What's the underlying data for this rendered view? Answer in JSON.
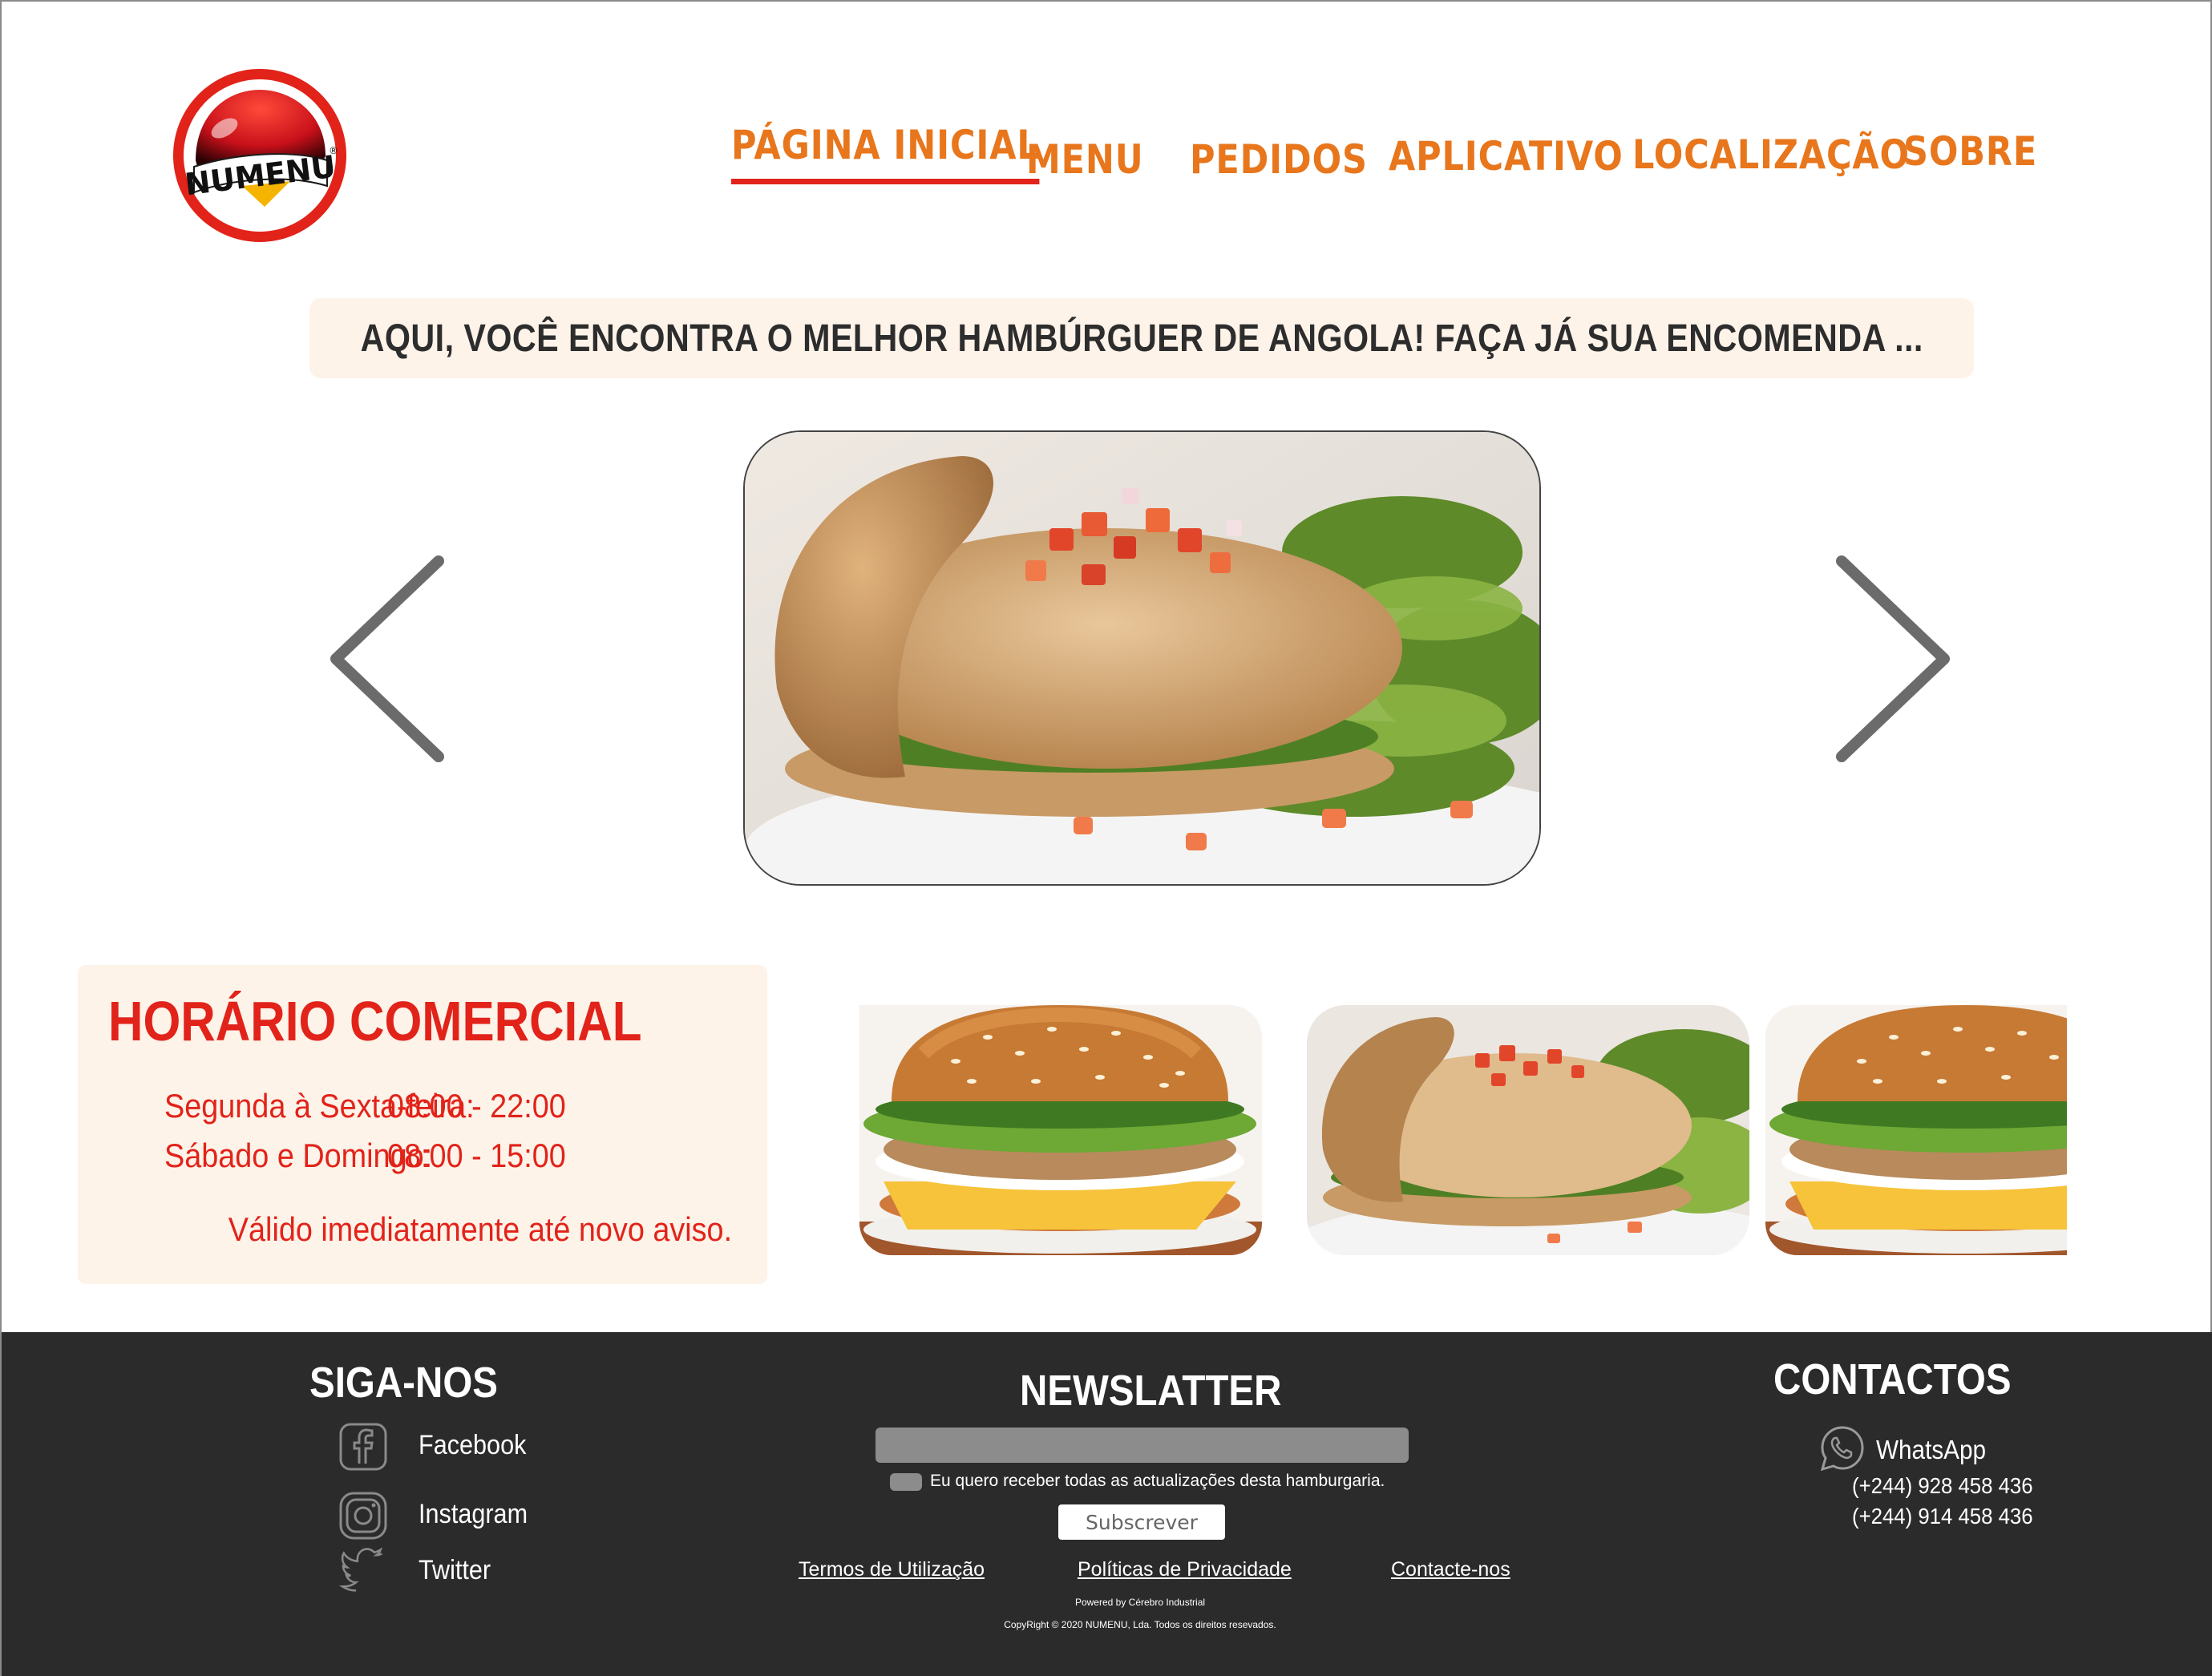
{
  "brand": {
    "logo_text": "NUMENU",
    "logo_registered": "®",
    "primary_color": "#e2231a",
    "nav_color": "#e8761c",
    "cream": "#fdf3e9",
    "footer_bg": "#2b2b2b"
  },
  "nav": {
    "items": [
      {
        "label": "PÁGINA INICIAL",
        "active": true
      },
      {
        "label": "MENU",
        "active": false
      },
      {
        "label": "PEDIDOS",
        "active": false
      },
      {
        "label": "APLICATIVO",
        "active": false
      },
      {
        "label": "LOCALIZAÇÃO",
        "active": false
      },
      {
        "label": "SOBRE",
        "active": false
      }
    ]
  },
  "tagline": "AQUI, VOCÊ ENCONTRA O MELHOR HAMBÚRGUER DE ANGOLA! FAÇA JÁ SUA ENCOMENDA ...",
  "carousel": {
    "prev_icon": "chevron-left-icon",
    "next_icon": "chevron-right-icon"
  },
  "hours": {
    "title": "HORÁRIO COMERCIAL",
    "rows": [
      {
        "days": "Segunda à Sexta-feira:",
        "time": "08:00 - 22:00"
      },
      {
        "days": "Sábado e Domingo:",
        "time": "08:00 - 15:00"
      }
    ],
    "note": "Válido imediatamente até novo aviso."
  },
  "footer": {
    "follow": {
      "title": "SIGA-NOS",
      "items": [
        {
          "label": "Facebook",
          "icon": "facebook-icon"
        },
        {
          "label": "Instagram",
          "icon": "instagram-icon"
        },
        {
          "label": "Twitter",
          "icon": "twitter-icon"
        }
      ]
    },
    "newsletter": {
      "title": "NEWSLATTER",
      "input_value": "",
      "checkbox_label": "Eu quero receber todas as actualizações desta hamburgaria.",
      "button": "Subscrever"
    },
    "contacts": {
      "title": "CONTACTOS",
      "whatsapp_label": "WhatsApp",
      "phones": [
        "(+244) 928 458 436",
        "(+244) 914 458 436"
      ]
    },
    "links": [
      "Termos de Utilização",
      "Políticas de Privacidade",
      "Contacte-nos"
    ],
    "powered": "Powered by Cérebro Industrial",
    "copyright": "CopyRight © 2020 NUMENU, Lda. Todos os direitos resevados."
  }
}
